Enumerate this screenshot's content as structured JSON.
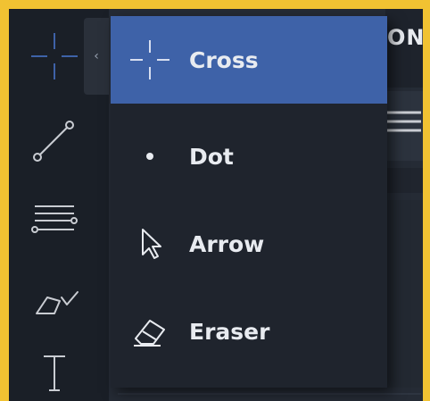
{
  "toolbar": {
    "tools": [
      {
        "icon": "crosshair-icon"
      },
      {
        "icon": "line-segment-icon"
      },
      {
        "icon": "horizontal-lines-icon"
      },
      {
        "icon": "pencil-tool-icon"
      },
      {
        "icon": "text-tool-icon"
      }
    ],
    "collapse_glyph": "‹"
  },
  "right_panel": {
    "partial_title": "ONT"
  },
  "cursor_menu": {
    "items": [
      {
        "label": "Cross",
        "icon": "cross-cursor-icon",
        "selected": true
      },
      {
        "label": "Dot",
        "icon": "dot-cursor-icon",
        "selected": false
      },
      {
        "label": "Arrow",
        "icon": "arrow-cursor-icon",
        "selected": false
      },
      {
        "label": "Eraser",
        "icon": "eraser-icon",
        "selected": false
      }
    ]
  },
  "colors": {
    "frame": "#f1c232",
    "accent": "#3e62a8",
    "toolbar_icon": "#c9ccd2",
    "active_tool_icon": "#3e62a8"
  }
}
